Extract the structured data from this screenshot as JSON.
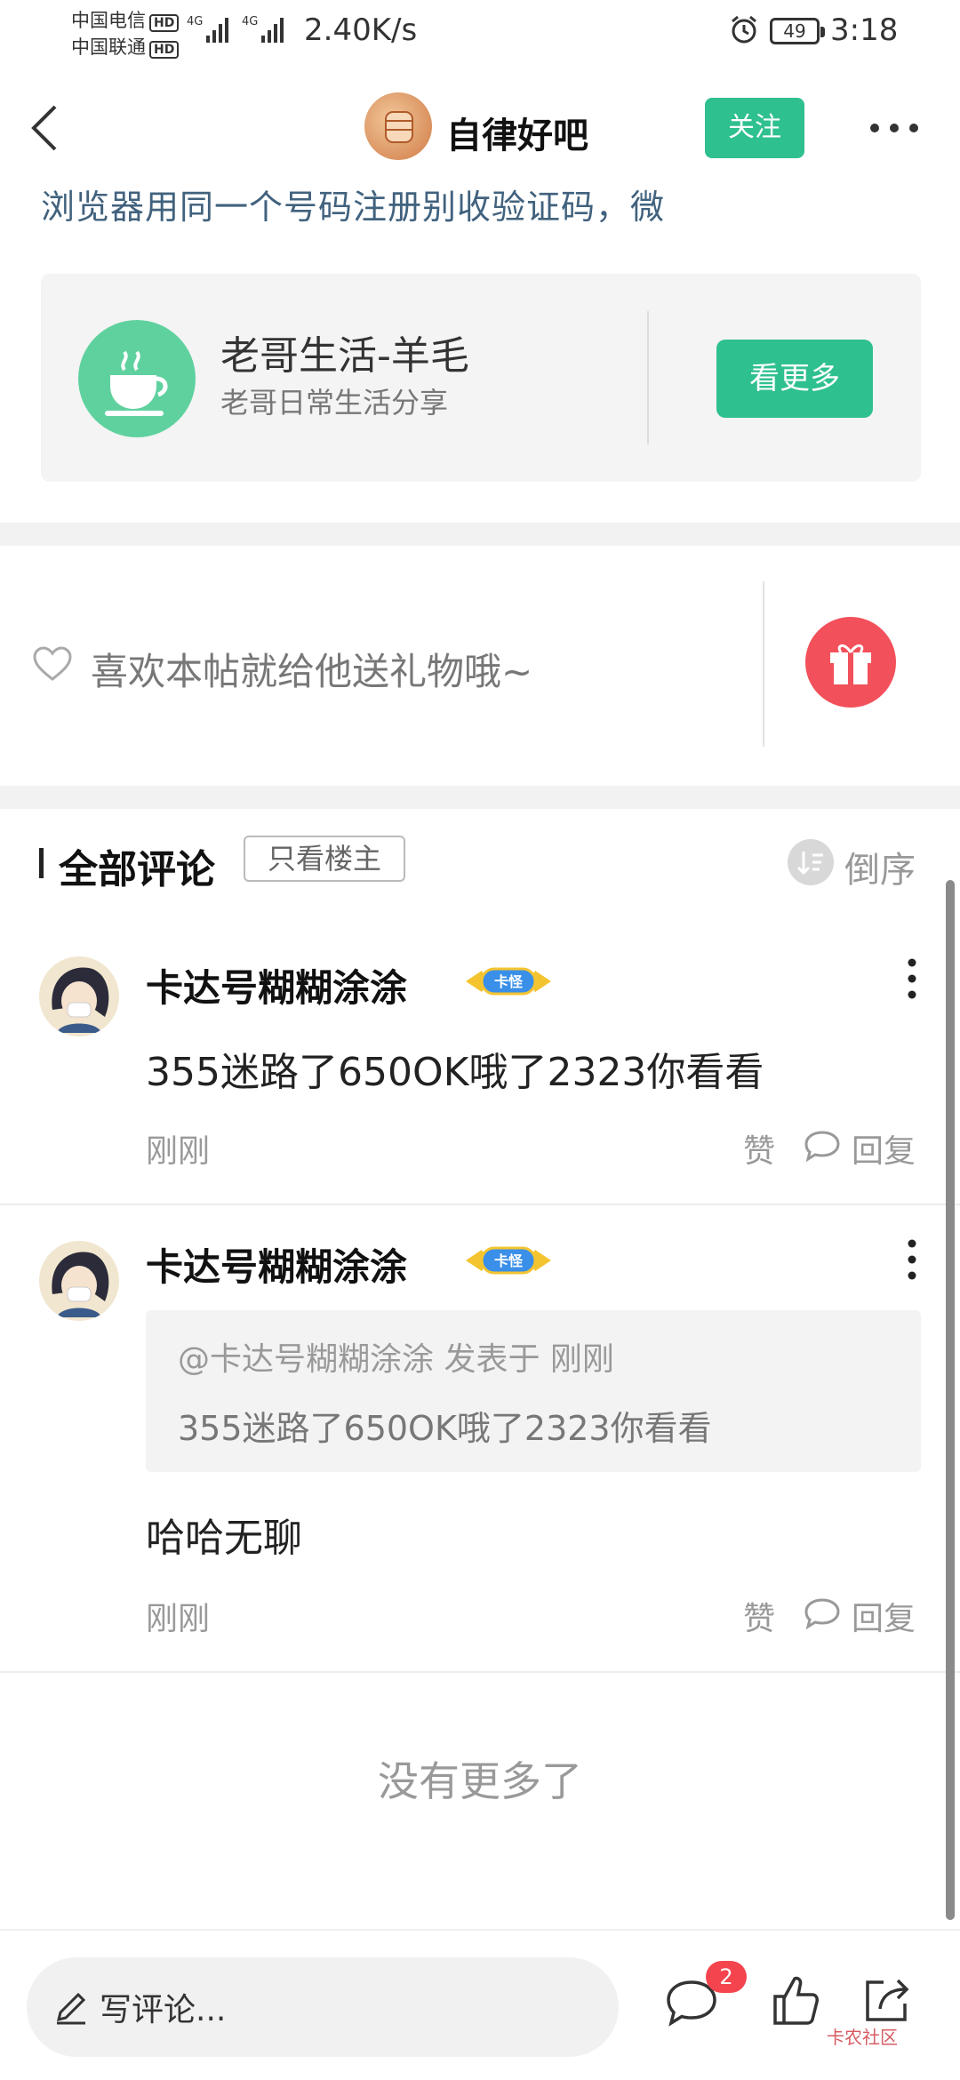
{
  "status_bar": {
    "carrier1": "中国电信",
    "carrier2": "中国联通",
    "hd": "HD",
    "network": "4G",
    "speed": "2.40K/s",
    "battery": "49",
    "time": "3:18"
  },
  "header": {
    "forum_name": "自律好吧",
    "follow_label": "关注",
    "forum_avatar_icon": "forum-avatar-icon"
  },
  "post": {
    "truncated_text": "浏览器用同一个号码注册别收验证码，微"
  },
  "source_card": {
    "title": "老哥生活-羊毛",
    "subtitle": "老哥日常生活分享",
    "button": "看更多",
    "icon": "coffee-cup-icon"
  },
  "gift": {
    "text": "喜欢本帖就给他送礼物哦~",
    "icon": "gift-icon"
  },
  "comments_section": {
    "title": "全部评论",
    "op_only": "只看楼主",
    "sort_label": "倒序"
  },
  "comments": [
    {
      "user": "卡达号糊糊涂涂",
      "badge": "卡怪",
      "body": "355迷路了650OK哦了2323你看看",
      "time": "刚刚",
      "like_label": "赞",
      "reply_label": "回复"
    },
    {
      "user": "卡达号糊糊涂涂",
      "badge": "卡怪",
      "quote_meta": "@卡达号糊糊涂涂 发表于 刚刚",
      "quote_text": "355迷路了650OK哦了2323你看看",
      "body": "哈哈无聊",
      "time": "刚刚",
      "like_label": "赞",
      "reply_label": "回复"
    }
  ],
  "footer": {
    "no_more": "没有更多了"
  },
  "bottom_bar": {
    "input_label": "写评论...",
    "comment_count": "2",
    "watermark": "卡农社区"
  },
  "colors": {
    "accent_green": "#2fc08f",
    "gift_red": "#f2505a",
    "badge_red": "#f4444e"
  }
}
